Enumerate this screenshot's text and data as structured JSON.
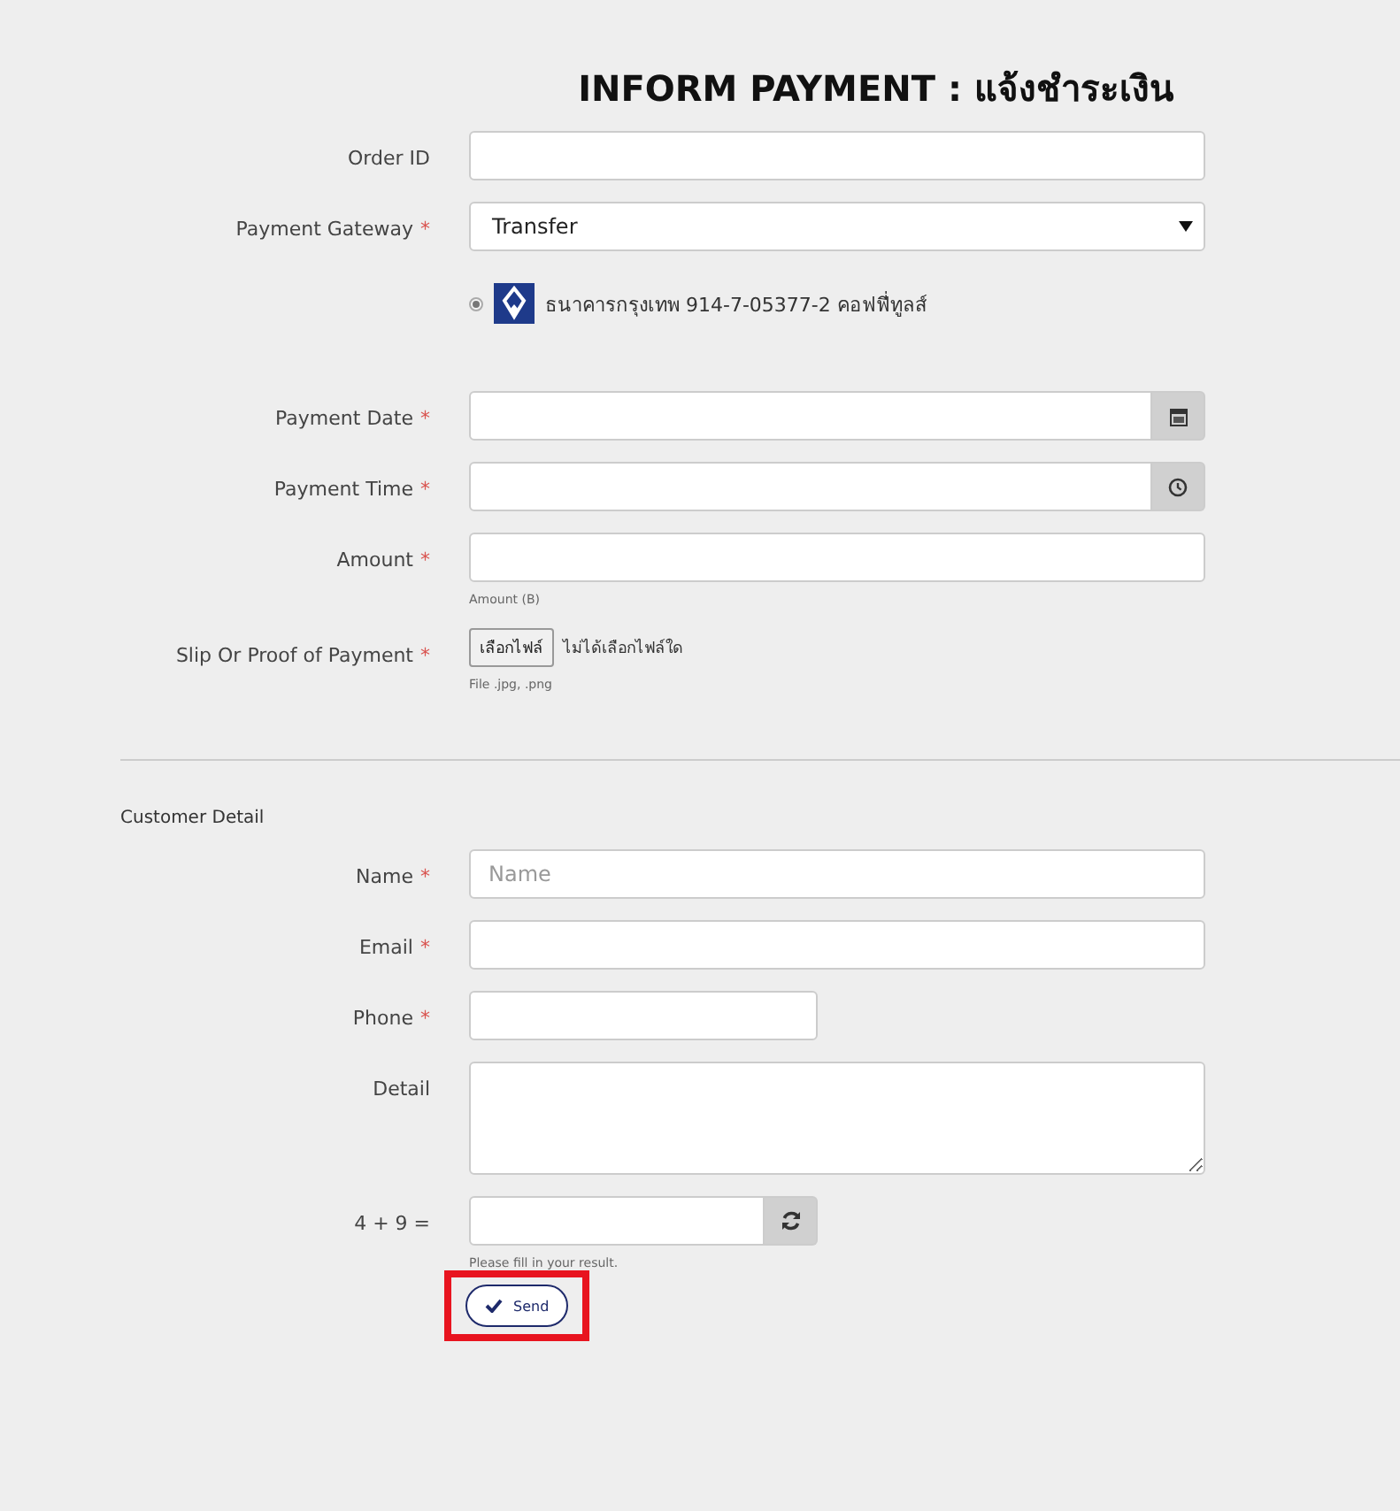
{
  "title": "INFORM PAYMENT : แจ้งชำระเงิน",
  "payment_fields": [
    {
      "kind": "text",
      "label": "Order ID"
    },
    {
      "kind": "select",
      "label": "Payment Gateway",
      "required_mark": "*",
      "value": "Transfer"
    },
    {
      "kind": "radio",
      "option": "ธนาคารกรุงเทพ  914-7-05377-2 คอฟฟี่ทูลส์",
      "selected": true
    },
    {
      "kind": "date",
      "label": "Payment Date",
      "required_mark": "*"
    },
    {
      "kind": "time",
      "label": "Payment Time",
      "required_mark": "*"
    },
    {
      "kind": "text",
      "label": "Amount",
      "required_mark": "*",
      "hint": "Amount (B)"
    },
    {
      "kind": "file",
      "label": "Slip Or Proof of Payment",
      "required_mark": "*",
      "button": "เลือกไฟล์",
      "status": "ไม่ได้เลือกไฟล์ใด",
      "hint": "File .jpg, .png"
    }
  ],
  "section_title": "Customer Detail",
  "customer_fields": [
    {
      "kind": "text",
      "label": "Name",
      "required_mark": "*",
      "placeholder": "Name"
    },
    {
      "kind": "text",
      "label": "Email",
      "required_mark": "*"
    },
    {
      "kind": "short",
      "label": "Phone",
      "required_mark": "*"
    },
    {
      "kind": "textarea",
      "label": "Detail"
    },
    {
      "kind": "captcha",
      "label": "4 + 9 =",
      "hint": "Please fill in your result."
    }
  ],
  "send_button": "Send",
  "send_highlighted": true
}
